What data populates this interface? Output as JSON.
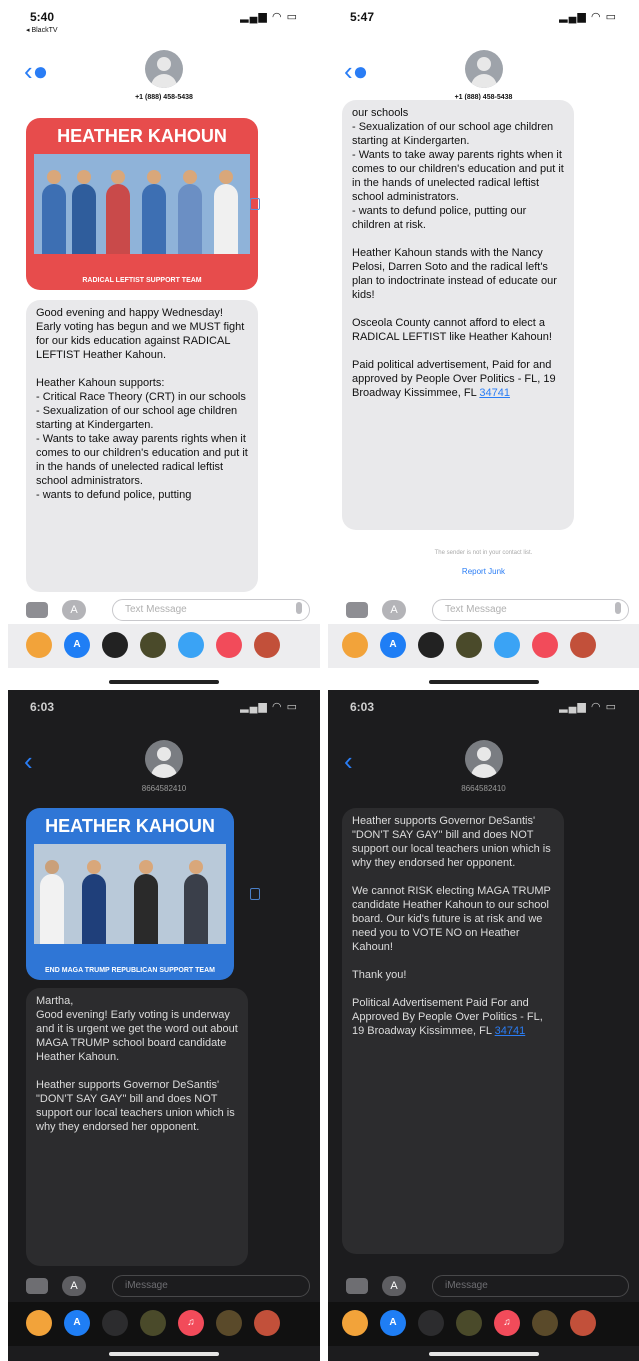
{
  "screens": [
    {
      "time": "5:40",
      "back_app": "◂ BlackTV",
      "contact": "+1 (888) 458-5438",
      "card": {
        "title": "HEATHER KAHOUN",
        "footer": "RADICAL LEFTIST SUPPORT TEAM",
        "color": "#e74c4c"
      },
      "message": "Good evening and happy Wednesday! Early voting has begun and we MUST fight for our kids education against RADICAL LEFTIST Heather Kahoun.\n\nHeather Kahoun supports:\n- Critical Race Theory (CRT) in our schools\n- Sexualization of our school age children starting at Kindergarten.\n- Wants to take away parents rights when it comes to our children's education and put it in the hands of unelected radical leftist school administrators.\n- wants to defund police, putting",
      "compose_placeholder": "Text Message"
    },
    {
      "time": "5:47",
      "contact": "+1 (888) 458-5438",
      "message": "our schools\n- Sexualization of our school age children starting at Kindergarten.\n- Wants to take away parents rights when it comes to our children's education and put it in the hands of unelected radical leftist school administrators.\n- wants to defund police, putting our children at risk.\n\nHeather Kahoun stands with the Nancy Pelosi, Darren Soto and the radical left's plan to indoctrinate instead of educate our kids!\n\nOsceola County cannot afford to elect a RADICAL LEFTIST like Heather Kahoun!\n\nPaid political advertisement, Paid for and approved by People Over Politics - FL, 19 Broadway Kissimmee, FL",
      "link": "34741",
      "note": "The sender is not in your contact list.",
      "report": "Report Junk",
      "compose_placeholder": "Text Message"
    },
    {
      "time": "6:03",
      "contact": "8664582410",
      "card": {
        "title": "HEATHER KAHOUN",
        "footer": "END MAGA TRUMP REPUBLICAN SUPPORT TEAM",
        "color": "#2f76d6"
      },
      "message": "Martha,\nGood evening! Early voting is underway and it is urgent we get the word out about MAGA TRUMP school board candidate Heather Kahoun.\n\nHeather supports Governor DeSantis' \"DON'T SAY GAY\" bill and does NOT support our local teachers union which is why they endorsed her opponent.",
      "compose_placeholder": "iMessage"
    },
    {
      "time": "6:03",
      "contact": "8664582410",
      "message": "Heather supports Governor DeSantis' \"DON'T SAY GAY\" bill and does NOT support our local teachers union which is why they endorsed her opponent.\n\nWe cannot RISK electing MAGA TRUMP candidate Heather Kahoun to our school board. Our kid's future is at risk and we need you to VOTE NO on Heather Kahoun!\n\nThank you!\n\nPolitical Advertisement Paid For and Approved By People Over Politics - FL, 19 Broadway Kissimmee, FL",
      "link": "34741",
      "compose_placeholder": "iMessage"
    }
  ],
  "colors": {
    "accent": "#2a7df5",
    "dark_bg": "#1c1c1e",
    "light_bubble": "#e9e9eb",
    "dark_bubble": "#2c2c2e"
  }
}
